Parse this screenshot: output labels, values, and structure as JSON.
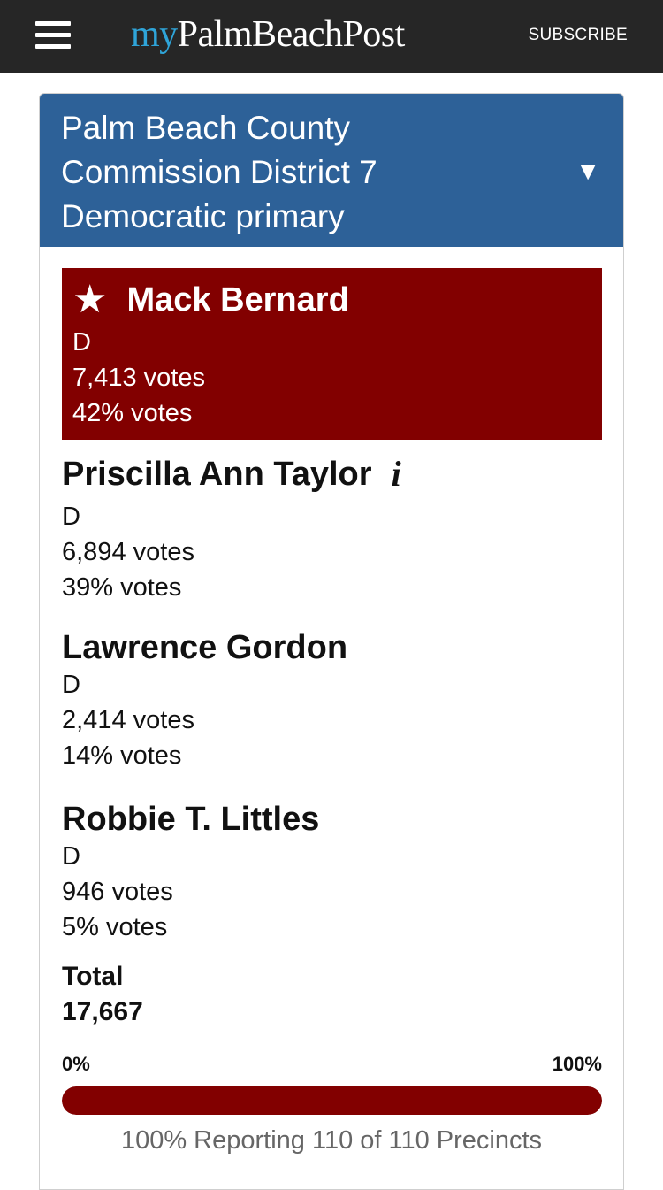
{
  "header": {
    "logo_my": "my",
    "logo_main": "PalmBeachPost",
    "subscribe_label": "SUBSCRIBE"
  },
  "race": {
    "title_lines": [
      "Palm Beach County",
      "Commission District 7",
      "Democratic primary"
    ],
    "caret": "▼"
  },
  "candidates": [
    {
      "name": "Mack Bernard",
      "party": "D",
      "votes": "7,413 votes",
      "pct": "42% votes",
      "winner": true
    },
    {
      "name": "Priscilla Ann Taylor",
      "party": "D",
      "votes": "6,894 votes",
      "pct": "39% votes",
      "info": "i"
    },
    {
      "name": "Lawrence Gordon",
      "party": "D",
      "votes": "2,414 votes",
      "pct": "14% votes"
    },
    {
      "name": "Robbie T. Littles",
      "party": "D",
      "votes": "946 votes",
      "pct": "5% votes"
    }
  ],
  "total": {
    "label": "Total",
    "value": "17,667"
  },
  "progress": {
    "min_label": "0%",
    "max_label": "100%",
    "fraction": 1.0,
    "reporting_text": "100% Reporting 110 of 110 Precincts"
  },
  "colors": {
    "winner": "#820000",
    "header_bg": "#2d6198",
    "topbar": "#262626",
    "logo_accent": "#2fa4d8"
  }
}
